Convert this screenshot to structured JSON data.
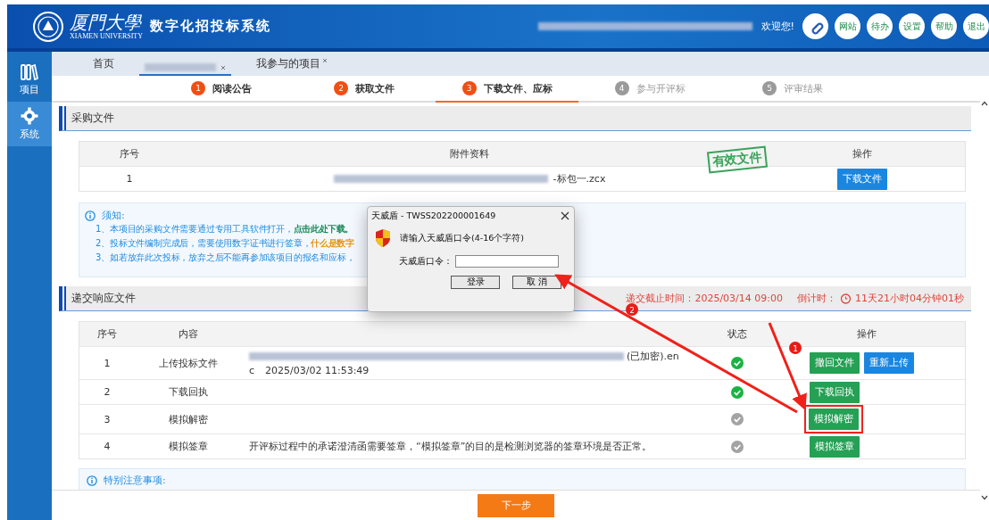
{
  "header": {
    "university_cn": "厦門大學",
    "university_en": "XIAMEN UNIVERSITY",
    "system_title": "数字化招投标系统",
    "welcome": "欢迎您!",
    "buttons": [
      {
        "kind": "link"
      },
      {
        "kind": "text",
        "label": "网站"
      },
      {
        "kind": "text",
        "label": "待办"
      },
      {
        "kind": "text",
        "label": "设置"
      },
      {
        "kind": "text",
        "label": "帮助"
      },
      {
        "kind": "text",
        "label": "退出"
      }
    ]
  },
  "sidebar": {
    "items": [
      {
        "kind": "books",
        "label": "项目",
        "selected": false
      },
      {
        "kind": "gear",
        "label": "系统",
        "selected": true
      }
    ]
  },
  "tabs": [
    {
      "kind": "text",
      "label": "首页",
      "closable": false,
      "selected": false
    },
    {
      "kind": "redacted",
      "closable": true,
      "selected": true
    },
    {
      "kind": "text",
      "label": "我参与的项目",
      "closable": true,
      "selected": false
    }
  ],
  "steps": [
    {
      "number": "1",
      "label": "阅读公告",
      "completed": true,
      "selected": false
    },
    {
      "number": "2",
      "label": "获取文件",
      "completed": true,
      "selected": false
    },
    {
      "number": "3",
      "label": "下载文件、应标",
      "completed": true,
      "selected": true
    },
    {
      "number": "4",
      "label": "参与开评标",
      "completed": false,
      "selected": false
    },
    {
      "number": "5",
      "label": "评审结果",
      "completed": false,
      "selected": false
    }
  ],
  "procurement": {
    "title": "采购文件",
    "columns": [
      "序号",
      "附件资料",
      "操作"
    ],
    "stamp": "有效文件",
    "rows": [
      {
        "index": "1",
        "file_suffix": "-标包一.zcx",
        "action": "下载文件"
      }
    ]
  },
  "notice": {
    "title": "须知:",
    "items": [
      {
        "text": "1、本项目的采购文件需要通过专用工具软件打开，",
        "link": "点击此处下载。",
        "color": "#1c8a5a"
      },
      {
        "text": "2、投标文件编制完成后，需要使用数字证书进行签章，",
        "link": "什么是数字",
        "color": "#e69514"
      },
      {
        "text": "3、如若放弃此次投标，放弃之后不能再参加该项目的报名和应标，"
      }
    ]
  },
  "submission": {
    "title": "递交响应文件",
    "deadline": "递交截止时间：2025/03/14 09:00",
    "countdown_label": "倒计时：",
    "countdown": "11天21小时04分钟01秒",
    "columns": [
      "序号",
      "内容",
      "状态",
      "操作"
    ],
    "rows": [
      {
        "index": "1",
        "name": "上传投标文件",
        "file": {
          "suffix": "(已加密).en",
          "wrap": "c",
          "time": "2025/03/02 11:53:49"
        },
        "done": true,
        "actions": [
          {
            "label": "撤回文件",
            "kind": "green",
            "highlighted": false
          },
          {
            "label": "重新上传",
            "kind": "blue",
            "highlighted": false
          }
        ]
      },
      {
        "index": "2",
        "name": "下载回执",
        "done": true,
        "actions": [
          {
            "label": "下载回执",
            "kind": "green",
            "highlighted": false
          }
        ]
      },
      {
        "index": "3",
        "name": "模拟解密",
        "done": false,
        "actions": [
          {
            "label": "模拟解密",
            "kind": "green",
            "highlighted": true
          }
        ]
      },
      {
        "index": "4",
        "name": "模拟签章",
        "description": "开评标过程中的承诺澄清函需要签章，“模拟签章”的目的是检测浏览器的签章环境是否正常。",
        "done": false,
        "actions": [
          {
            "label": "模拟签章",
            "kind": "green",
            "highlighted": false
          }
        ]
      }
    ]
  },
  "special_notice": {
    "title": "特别注意事项:"
  },
  "next_button": "下一步",
  "dialog": {
    "title": "天威盾 - TWSS202200001649",
    "prompt": "请输入天威盾口令(4-16个字符)",
    "field_label": "天威盾口令：",
    "ok": "登录",
    "cancel": "取 消"
  },
  "annotations": [
    {
      "number": "1"
    },
    {
      "number": "2"
    }
  ]
}
